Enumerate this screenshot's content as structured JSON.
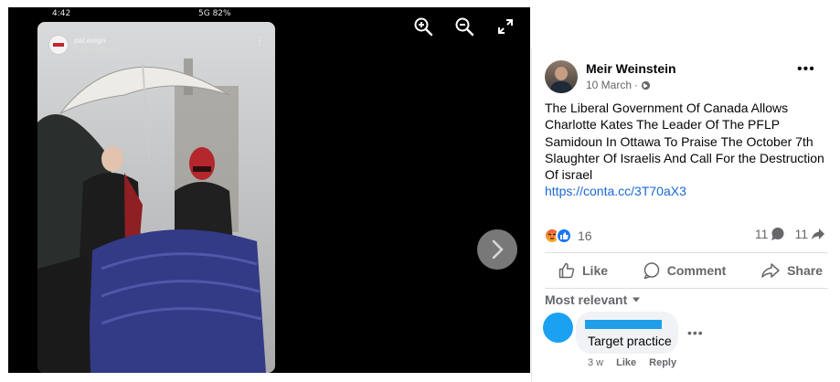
{
  "viewer": {
    "status_time": "4:42",
    "status_network": "5G",
    "status_battery": "82%",
    "story_user": "pal.esign",
    "story_sub": "Public · Ottawa",
    "tools": [
      "zoom-in-icon",
      "zoom-out-icon",
      "fullscreen-icon"
    ]
  },
  "post": {
    "author": "Meir Weinstein",
    "date": "10 March",
    "audience_icon": "globe-icon",
    "text": "The Liberal Government Of Canada Allows Charlotte Kates The Leader Of The PFLP Samidoun In Ottawa To Praise The October 7th Slaughter Of Israelis And Call For the Destruction Of israel",
    "link": "https://conta.cc/3T70aX3",
    "reaction_count": "16",
    "comment_count": "11",
    "share_count": "11",
    "actions": {
      "like": "Like",
      "comment": "Comment",
      "share": "Share"
    },
    "sort_label": "Most relevant"
  },
  "comment": {
    "text": "Target practice",
    "age": "3 w",
    "like": "Like",
    "reply": "Reply"
  },
  "colors": {
    "link": "#1a67d6",
    "like_blue": "#1877f2",
    "muted": "#65676b"
  }
}
